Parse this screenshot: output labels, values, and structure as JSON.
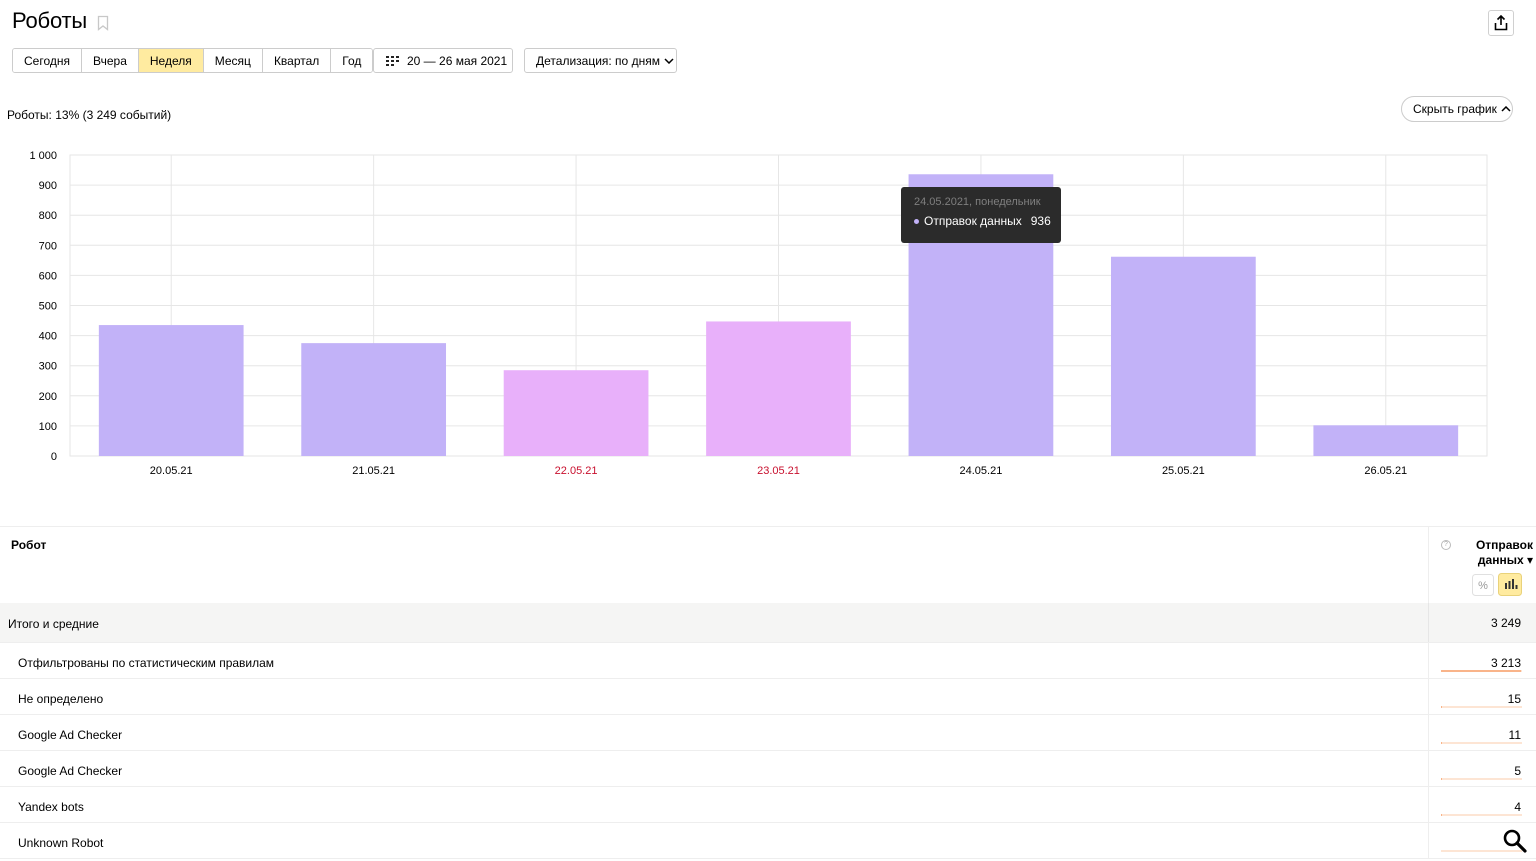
{
  "page": {
    "title": "Роботы"
  },
  "periods": [
    "Сегодня",
    "Вчера",
    "Неделя",
    "Месяц",
    "Квартал",
    "Год"
  ],
  "active_period": "Неделя",
  "date_range": "20 — 26 мая 2021",
  "detail": "Детализация: по дням",
  "summary": "Роботы: 13% (3 249 событий)",
  "hide_chart": "Скрыть график",
  "chart_data": {
    "type": "bar",
    "categories": [
      "20.05.21",
      "21.05.21",
      "22.05.21",
      "23.05.21",
      "24.05.21",
      "25.05.21",
      "26.05.21"
    ],
    "values": [
      435,
      375,
      285,
      447,
      936,
      662,
      102
    ],
    "weekend": [
      false,
      false,
      true,
      true,
      false,
      false,
      false
    ],
    "ylim": [
      0,
      1000
    ],
    "yticks": [
      "0",
      "100",
      "200",
      "300",
      "400",
      "500",
      "600",
      "700",
      "800",
      "900",
      "1 000"
    ],
    "colors": {
      "weekday": "#c2b2f8",
      "weekend": "#e8b0fa",
      "weekend_label": "#c8102e",
      "grid": "#e6e6e6"
    },
    "xlabel": "",
    "ylabel": ""
  },
  "tooltip": {
    "date": "24.05.2021, понедельник",
    "series": "Отправок данных",
    "value": "936"
  },
  "table": {
    "col_dim": "Робот",
    "col_metric": "Отправок данных",
    "sort_indicator": "▾",
    "total": {
      "label": "Итого и средние",
      "value": "3 249"
    },
    "rows": [
      {
        "label": "Отфильтрованы по статистическим правилам",
        "value": "3 213",
        "share": 0.989
      },
      {
        "label": "Не определено",
        "value": "15",
        "share": 0.005
      },
      {
        "label": "Google Ad Checker",
        "value": "11",
        "share": 0.003
      },
      {
        "label": "Google Ad Checker",
        "value": "5",
        "share": 0.002
      },
      {
        "label": "Yandex bots",
        "value": "4",
        "share": 0.001
      },
      {
        "label": "Unknown Robot",
        "value": "",
        "share": 0.0
      }
    ]
  }
}
